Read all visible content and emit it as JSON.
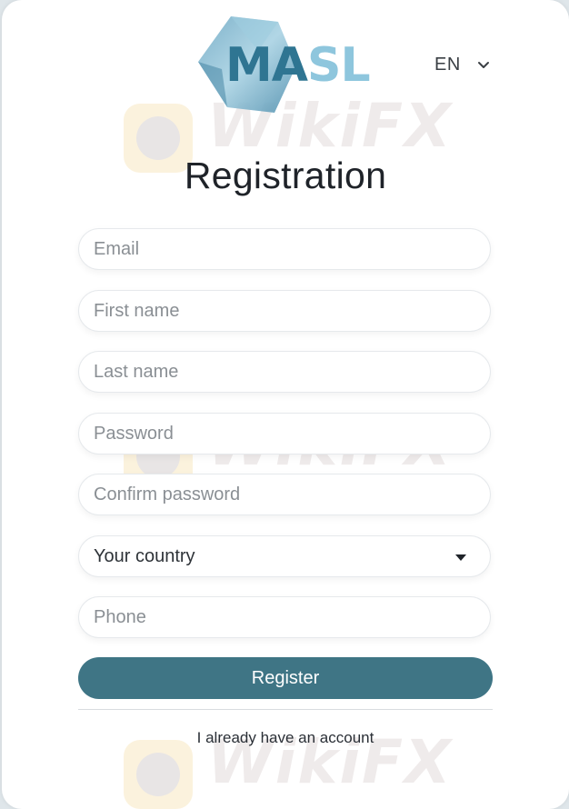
{
  "brand": {
    "logo_left": "MA",
    "logo_right": "SL"
  },
  "language": {
    "current": "EN"
  },
  "page": {
    "title": "Registration"
  },
  "form": {
    "email_placeholder": "Email",
    "first_name_placeholder": "First name",
    "last_name_placeholder": "Last name",
    "password_placeholder": "Password",
    "confirm_password_placeholder": "Confirm password",
    "country_selected": "Your country",
    "phone_placeholder": "Phone",
    "register_label": "Register",
    "login_link": "I already have an account"
  },
  "watermark": {
    "text": "WikiFX"
  },
  "colors": {
    "accent": "#3f7585",
    "logo_dark": "#2f7592",
    "logo_light": "#8ec6dd"
  }
}
